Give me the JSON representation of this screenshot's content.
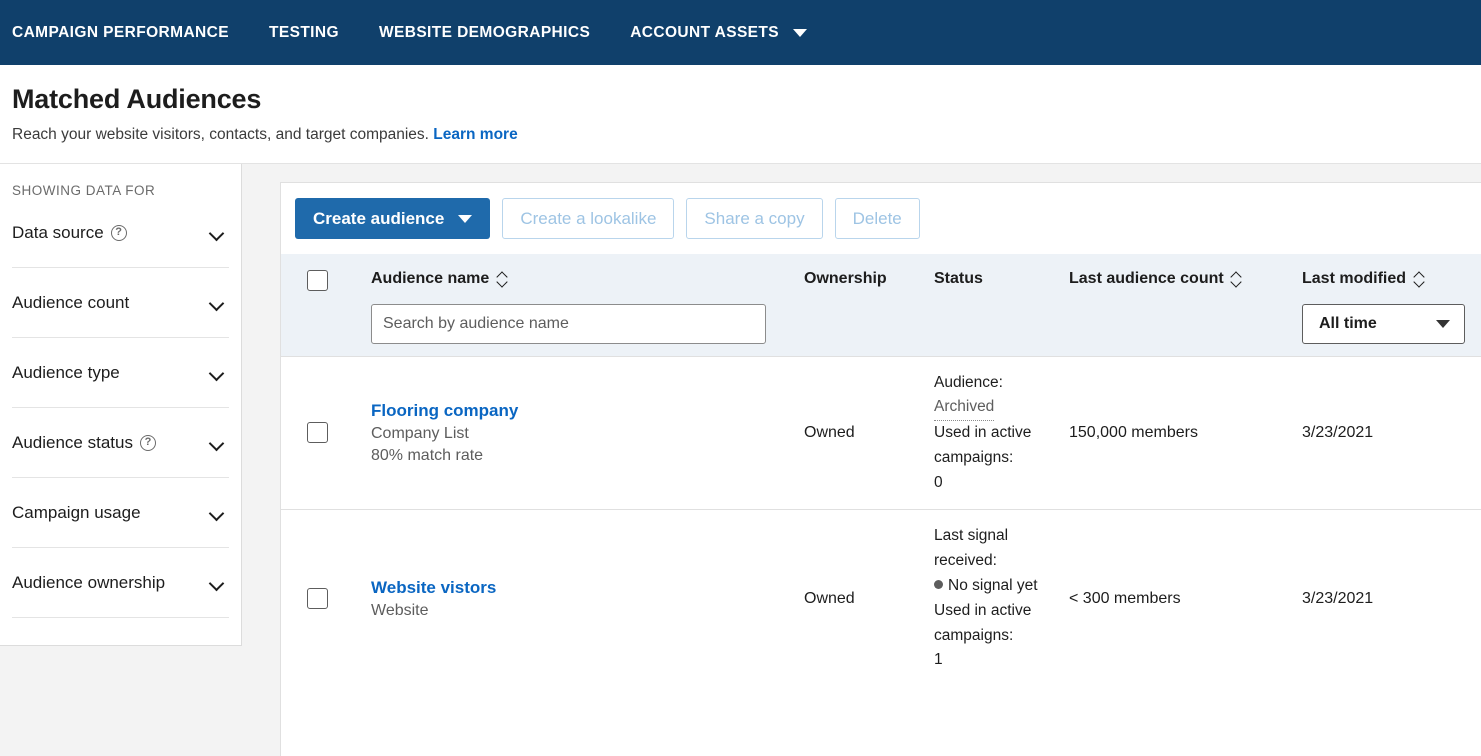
{
  "topnav": {
    "items": [
      {
        "label": "CAMPAIGN PERFORMANCE",
        "has_caret": false
      },
      {
        "label": "TESTING",
        "has_caret": false
      },
      {
        "label": "WEBSITE DEMOGRAPHICS",
        "has_caret": false
      },
      {
        "label": "ACCOUNT ASSETS",
        "has_caret": true
      }
    ],
    "background": "#10406b"
  },
  "header": {
    "title": "Matched Audiences",
    "subtitle": "Reach your website visitors, contacts, and target companies.",
    "learn_more": "Learn more",
    "link_color": "#0a66c2"
  },
  "sidebar": {
    "section_label": "SHOWING DATA FOR",
    "filters": [
      {
        "label": "Data source",
        "has_help": true
      },
      {
        "label": "Audience count",
        "has_help": false
      },
      {
        "label": "Audience type",
        "has_help": false
      },
      {
        "label": "Audience status",
        "has_help": true
      },
      {
        "label": "Campaign usage",
        "has_help": false
      },
      {
        "label": "Audience ownership",
        "has_help": false
      }
    ],
    "help_glyph": "?"
  },
  "toolbar": {
    "create_audience": "Create audience",
    "create_lookalike": "Create a lookalike",
    "share_copy": "Share a copy",
    "delete": "Delete",
    "primary_color": "#1f6aab"
  },
  "table": {
    "columns": {
      "audience_name": "Audience name",
      "ownership": "Ownership",
      "status": "Status",
      "last_audience_count": "Last audience count",
      "last_modified": "Last modified"
    },
    "search_placeholder": "Search by audience name",
    "search_value": "",
    "time_filter": "All time",
    "rows": [
      {
        "name": "Flooring company",
        "type": "Company List",
        "extra": "80% match rate",
        "ownership": "Owned",
        "status_label": "Audience:",
        "status_value": "Archived",
        "status_value_style": "dotted-underline",
        "status_dot": false,
        "usage_label": "Used in active campaigns:",
        "usage_value": "0",
        "count": "150,000 members",
        "modified": "3/23/2021"
      },
      {
        "name": "Website vistors",
        "type": "Website",
        "extra": "",
        "ownership": "Owned",
        "status_label": "Last signal received:",
        "status_value": "No signal yet",
        "status_value_style": "dot",
        "status_dot": true,
        "usage_label": "Used in active campaigns:",
        "usage_value": "1",
        "count": "< 300 members",
        "modified": "3/23/2021"
      }
    ]
  }
}
